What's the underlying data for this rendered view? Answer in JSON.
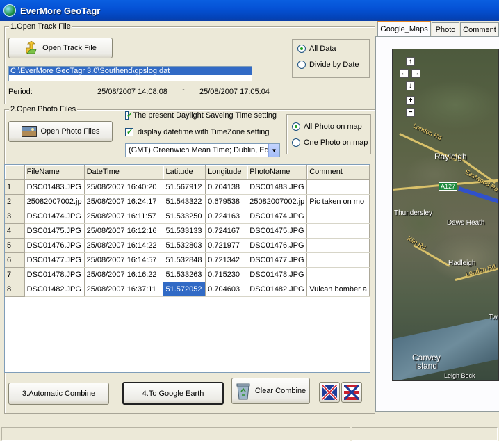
{
  "window": {
    "title": "EverMore GeoTagr"
  },
  "track": {
    "group_label": "1.Open Track File",
    "open_button": "Open Track File",
    "path": "C:\\EverMore GeoTagr 3.0\\Southend\\gpslog.dat",
    "period_label": "Period:",
    "period_start": "25/08/2007 14:08:08",
    "period_sep": "~",
    "period_end": "25/08/2007 17:05:04",
    "options": [
      {
        "label": "All Data",
        "selected": true
      },
      {
        "label": "Divide by Date",
        "selected": false
      }
    ]
  },
  "photos": {
    "group_label": "2.Open Photo Files",
    "open_button": "Open Photo Files",
    "dst_label": "The present Daylight Saveing Time setting",
    "dst_checked": true,
    "tz_label": "display datetime with TimeZone setting",
    "tz_checked": true,
    "timezone": "(GMT) Greenwich Mean Time; Dublin, Edin",
    "options": [
      {
        "label": "All  Photo on map",
        "selected": true
      },
      {
        "label": "One Photo on map",
        "selected": false
      }
    ]
  },
  "table": {
    "columns": [
      "FileName",
      "DateTime",
      "Latitude",
      "Longitude",
      "PhotoName",
      "Comment"
    ],
    "rows": [
      {
        "n": "1",
        "file": "DSC01483.JPG",
        "datetime": "25/08/2007 16:40:20",
        "lat": "51.567912",
        "lon": "0.704138",
        "photo": "DSC01483.JPG",
        "comment": ""
      },
      {
        "n": "2",
        "file": "25082007002.jp",
        "datetime": "25/08/2007 16:24:17",
        "lat": "51.543322",
        "lon": "0.679538",
        "photo": "25082007002.jp",
        "comment": "Pic taken on mo"
      },
      {
        "n": "3",
        "file": "DSC01474.JPG",
        "datetime": "25/08/2007 16:11:57",
        "lat": "51.533250",
        "lon": "0.724163",
        "photo": "DSC01474.JPG",
        "comment": ""
      },
      {
        "n": "4",
        "file": "DSC01475.JPG",
        "datetime": "25/08/2007 16:12:16",
        "lat": "51.533133",
        "lon": "0.724167",
        "photo": "DSC01475.JPG",
        "comment": ""
      },
      {
        "n": "5",
        "file": "DSC01476.JPG",
        "datetime": "25/08/2007 16:14:22",
        "lat": "51.532803",
        "lon": "0.721977",
        "photo": "DSC01476.JPG",
        "comment": ""
      },
      {
        "n": "6",
        "file": "DSC01477.JPG",
        "datetime": "25/08/2007 16:14:57",
        "lat": "51.532848",
        "lon": "0.721342",
        "photo": "DSC01477.JPG",
        "comment": ""
      },
      {
        "n": "7",
        "file": "DSC01478.JPG",
        "datetime": "25/08/2007 16:16:22",
        "lat": "51.533263",
        "lon": "0.715230",
        "photo": "DSC01478.JPG",
        "comment": ""
      },
      {
        "n": "8",
        "file": "DSC01482.JPG",
        "datetime": "25/08/2007 16:37:11",
        "lat": "51.572052",
        "lon": "0.704603",
        "photo": "DSC01482.JPG",
        "comment": "Vulcan bomber a"
      }
    ]
  },
  "actions": {
    "auto_combine": "3.Automatic Combine",
    "google_earth": "4.To Google Earth",
    "clear_combine": "Clear Combine"
  },
  "tabs": [
    "Google_Maps",
    "Photo",
    "Comment"
  ],
  "map": {
    "labels": {
      "london_rd": "London Rd",
      "rayleigh": "Rayleigh",
      "eastwood_rd": "Eastwood Rd",
      "a127": "A127",
      "thundersley": "Thundersley",
      "daws_heath": "Daws Heath",
      "kiln_rd": "Kiln Rd",
      "hadleigh": "Hadleigh",
      "london_rd_2": "London Rd",
      "canvey": "Canvey",
      "island": "Island",
      "leigh_beck": "Leigh Beck",
      "two": "Two"
    }
  }
}
